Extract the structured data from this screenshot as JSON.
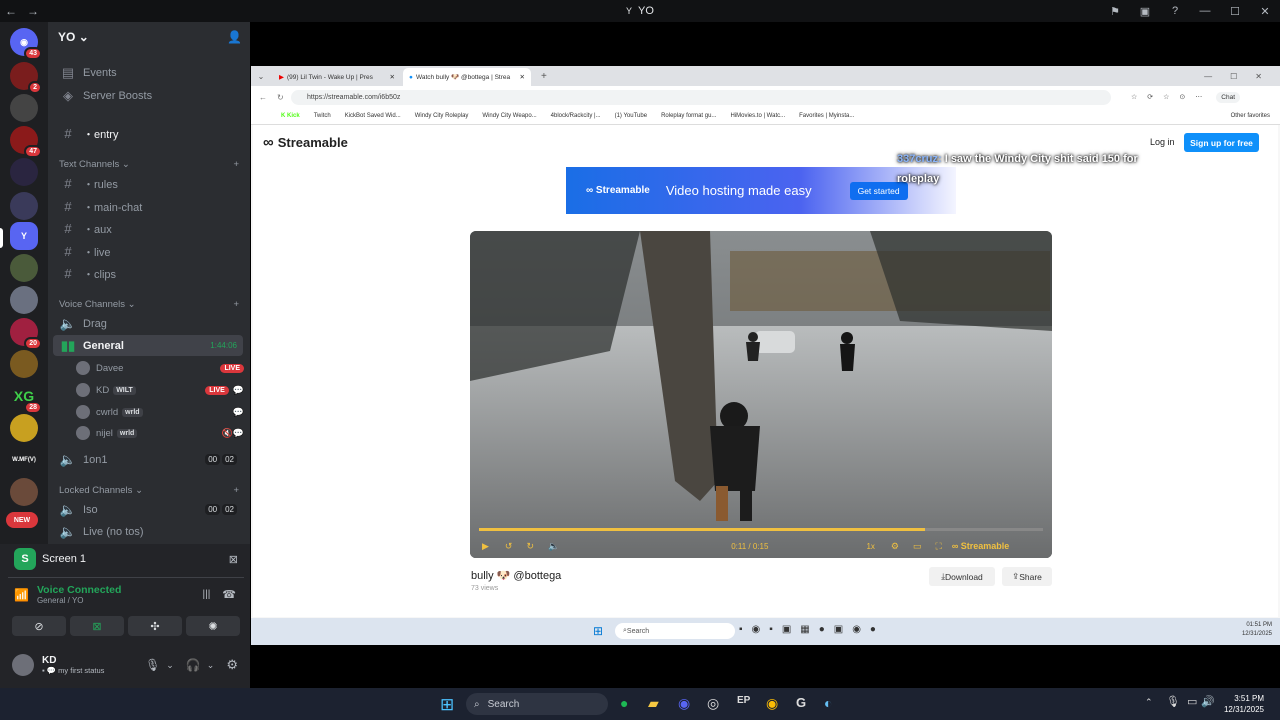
{
  "window": {
    "title": "YO"
  },
  "servers": [
    {
      "badge": "43"
    },
    {
      "label": "",
      "badge": "2"
    },
    {
      "label": ""
    },
    {
      "badge": "47"
    },
    {
      "label": ""
    },
    {
      "label": ""
    },
    {
      "label": "Y"
    },
    {
      "label": ""
    },
    {
      "label": ""
    },
    {
      "badge": "20"
    },
    {
      "label": ""
    },
    {
      "label": "XG",
      "badge": "28"
    },
    {
      "label": ""
    },
    {
      "label": "W.MF(V)"
    },
    {
      "label": ""
    },
    {
      "label": "NEW"
    }
  ],
  "server": {
    "name": "YO"
  },
  "nav": {
    "events": "Events",
    "boosts": "Server Boosts",
    "entry": "・entry"
  },
  "categories": {
    "text": "Text Channels",
    "voice": "Voice Channels",
    "locked": "Locked Channels"
  },
  "text_channels": [
    "・rules",
    "・main-chat",
    "・aux",
    "・live",
    "・clips"
  ],
  "voice_channels": {
    "drag": "Drag",
    "general": "General",
    "general_time": "1:44:06",
    "oneonone": "1on1",
    "oneonone_counts": [
      "00",
      "02"
    ],
    "iso": "Iso",
    "iso_counts": [
      "00",
      "02"
    ],
    "live_no_tos": "Live (no tos)"
  },
  "voice_users": [
    {
      "name": "Davee",
      "live": "LIVE"
    },
    {
      "name": "KD",
      "tag": "WILT",
      "live": "LIVE"
    },
    {
      "name": "cwrld",
      "tag": "wrld"
    },
    {
      "name": "nijel",
      "tag": "wrld"
    }
  ],
  "screen": {
    "title": "Screen 1"
  },
  "voice": {
    "status": "Voice Connected",
    "location": "General / YO"
  },
  "user": {
    "name": "KD",
    "status": "my first status"
  },
  "browser": {
    "tabs": [
      "(99) Lil Twin - Wake Up | Pres",
      "Watch bully 🐶 @bottega | Strea"
    ],
    "url": "https://streamable.com/i6b50z",
    "bookmarks": [
      "Kick",
      "Twitch",
      "KickBot Saved Wid...",
      "Windy City Roleplay",
      "Windy City Weapo...",
      "4block/Rackcity |...",
      "(1) YouTube",
      "Roleplay format gu...",
      "HiMovies.to | Watc...",
      "Favorites | Myinsta..."
    ],
    "other_favorites": "Other favorites",
    "chat_label": "Chat"
  },
  "streamable": {
    "logo": "Streamable",
    "login": "Log in",
    "signup": "Sign up for free",
    "banner_brand": "Streamable",
    "banner_text": "Video hosting made easy",
    "banner_cta": "Get started",
    "video_title": "bully 🐶 @bottega",
    "views": "73 views",
    "download": "Download",
    "share": "Share",
    "time": "0:11 / 0:15",
    "speed": "1x",
    "watermark": "Streamable",
    "progress": 0.79
  },
  "overlay_chat": {
    "user": "337cruz:",
    "message": "I saw the Windy City shit said 150 for roleplay"
  },
  "inner_taskbar": {
    "search": "Search",
    "time": "01:51 PM",
    "date": "12/31/2025"
  },
  "taskbar": {
    "search": "Search",
    "time": "3:51 PM",
    "date": "12/31/2025"
  },
  "colors": {
    "discord_bg": "#2b2d31",
    "accent_green": "#23a55a",
    "live_red": "#da373c",
    "streamable_blue": "#0f90fa"
  }
}
